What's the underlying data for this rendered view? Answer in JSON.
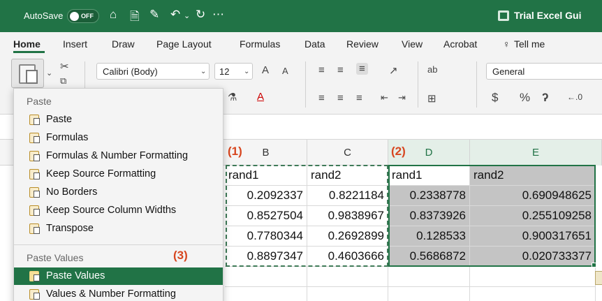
{
  "titlebar": {
    "autosave_label": "AutoSave",
    "autosave_state": "OFF",
    "doc_title": "Trial Excel Gui"
  },
  "tabs": [
    "Home",
    "Insert",
    "Draw",
    "Page Layout",
    "Formulas",
    "Data",
    "Review",
    "View",
    "Acrobat",
    "Tell me"
  ],
  "ribbon": {
    "font_name": "Calibri (Body)",
    "font_size": "12",
    "number_format": "General",
    "grow_font": "A",
    "shrink_font": "A",
    "currency": "$",
    "percent": "%",
    "comma": "ʔ"
  },
  "columns": {
    "b": "B",
    "c": "C",
    "d": "D",
    "e": "E"
  },
  "markers": {
    "m1": "(1)",
    "m2": "(2)",
    "m3": "(3)"
  },
  "grid": {
    "headers": [
      "rand1",
      "rand2",
      "rand1",
      "rand2"
    ],
    "rows": [
      [
        "0.2092337",
        "0.8221184",
        "0.2338778",
        "0.690948625"
      ],
      [
        "0.8527504",
        "0.9838967",
        "0.8373926",
        "0.255109258"
      ],
      [
        "0.7780344",
        "0.2692899",
        "0.128533",
        "0.900317651"
      ],
      [
        "0.8897347",
        "0.4603666",
        "0.5686872",
        "0.020733377"
      ]
    ]
  },
  "paste_menu": {
    "section_paste": "Paste",
    "items_paste": [
      "Paste",
      "Formulas",
      "Formulas & Number Formatting",
      "Keep Source Formatting",
      "No Borders",
      "Keep Source Column Widths",
      "Transpose"
    ],
    "section_values": "Paste Values",
    "items_values": [
      "Paste Values",
      "Values & Number Formatting"
    ],
    "highlighted": "Paste Values"
  },
  "colors": {
    "accent": "#217346",
    "marker": "#d7461f",
    "selection_fill": "#c4c4c4"
  }
}
